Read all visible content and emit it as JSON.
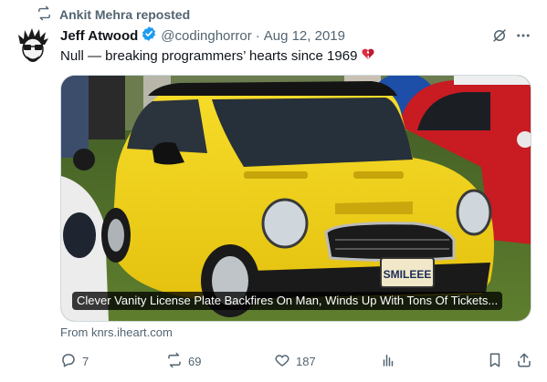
{
  "repost": {
    "label": "Ankit Mehra reposted",
    "icon": "repost-icon"
  },
  "author": {
    "name": "Jeff Atwood",
    "handle": "@codinghorror",
    "separator": "·",
    "date": "Aug 12, 2019",
    "verified": true
  },
  "tweet": {
    "text": "Null — breaking programmers’ hearts since 1969",
    "emoji": "broken-heart"
  },
  "card": {
    "title": "Clever Vanity License Plate Backfires On Man, Winds Up With Tons Of Tickets...",
    "plate": "SMILEEE",
    "source": "From knrs.iheart.com"
  },
  "actions": {
    "replies": "7",
    "reposts": "69",
    "likes": "187"
  },
  "colors": {
    "text_primary": "#0f1419",
    "text_secondary": "#536471",
    "verified": "#1d9bf0",
    "car_yellow": "#f2d21c"
  }
}
